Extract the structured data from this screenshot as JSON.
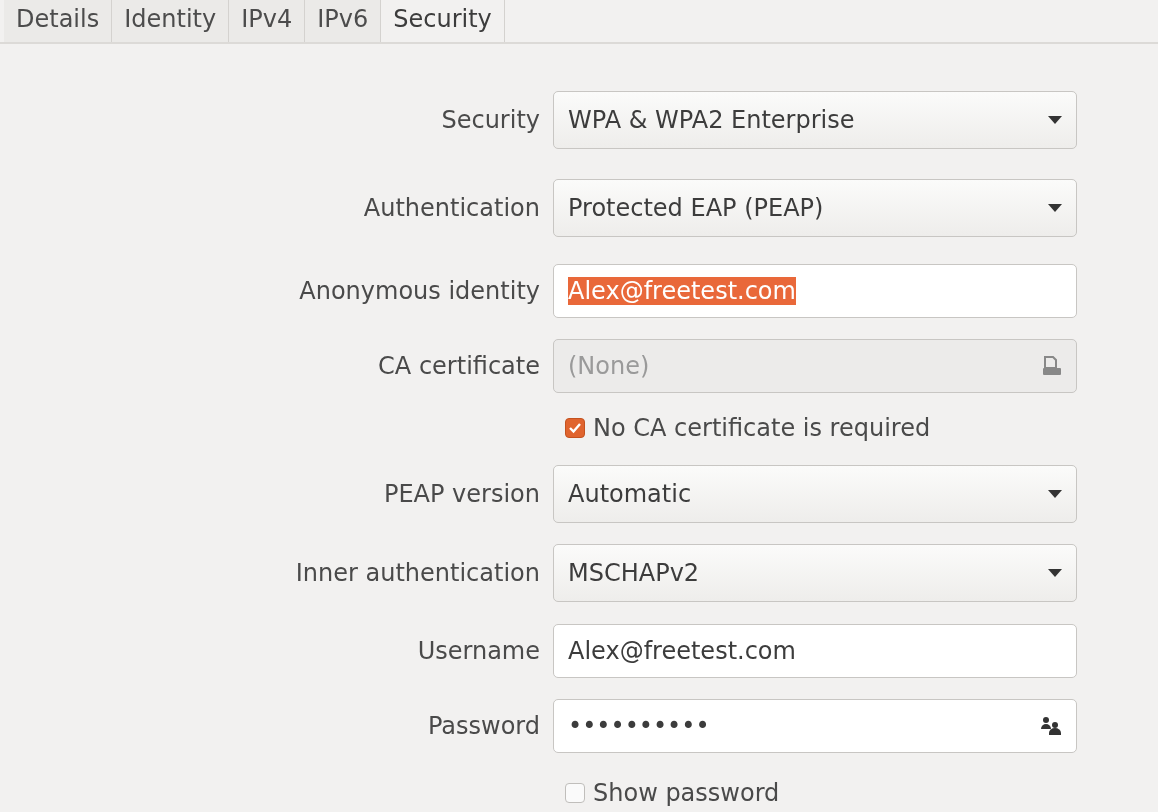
{
  "tabs": [
    {
      "label": "Details",
      "selected": false
    },
    {
      "label": "Identity",
      "selected": false
    },
    {
      "label": "IPv4",
      "selected": false
    },
    {
      "label": "IPv6",
      "selected": false
    },
    {
      "label": "Security",
      "selected": true
    }
  ],
  "rows": [
    {
      "kind": "dropdown",
      "label": "Security",
      "value": "WPA & WPA2 Enterprise"
    },
    {
      "kind": "dropdown",
      "label": "Authentication",
      "value": "Protected EAP (PEAP)"
    },
    {
      "kind": "field",
      "label": "Anonymous identity",
      "value": "Alex@freetest.com",
      "text_selected": true
    },
    {
      "kind": "file",
      "label": "CA certificate",
      "value": "(None)",
      "disabled": true
    },
    {
      "kind": "checkbox",
      "label": "No CA certificate is required",
      "checked": true
    },
    {
      "kind": "dropdown",
      "label": "PEAP version",
      "value": "Automatic"
    },
    {
      "kind": "dropdown",
      "label": "Inner authentication",
      "value": "MSCHAPv2"
    },
    {
      "kind": "field",
      "label": "Username",
      "value": "Alex@freetest.com",
      "text_selected": false
    },
    {
      "kind": "password",
      "label": "Password",
      "value": "••••••••••"
    },
    {
      "kind": "checkbox",
      "label": "Show password",
      "checked": false
    }
  ]
}
